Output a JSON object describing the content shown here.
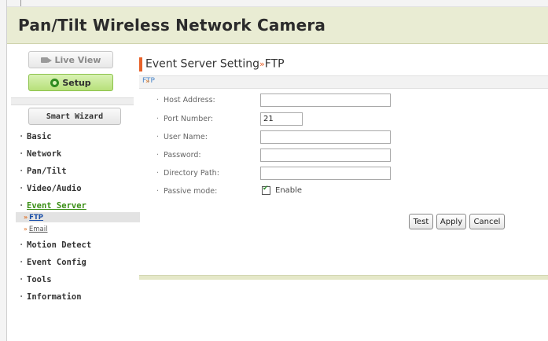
{
  "header": {
    "title": "Pan/Tilt Wireless Network Camera"
  },
  "nav": {
    "live_view": "Live View",
    "setup": "Setup",
    "smart_wizard": "Smart Wizard"
  },
  "menu": {
    "basic": "Basic",
    "network": "Network",
    "pan_tilt": "Pan/Tilt",
    "video_audio": "Video/Audio",
    "event_server": "Event Server",
    "sub_ftp": "FTP",
    "sub_email": "Email",
    "motion_detect": "Motion Detect",
    "event_config": "Event Config",
    "tools": "Tools",
    "information": "Information"
  },
  "page": {
    "title": "Event Server Setting",
    "title_sep": "»",
    "subtitle": "FTP",
    "section_prefix": "»",
    "section": "FTP"
  },
  "form": {
    "host_label": "Host Address:",
    "host_value": "",
    "port_label": "Port Number:",
    "port_value": "21",
    "user_label": "User Name:",
    "user_value": "",
    "password_label": "Password:",
    "password_value": "",
    "dir_label": "Directory Path:",
    "dir_value": "",
    "passive_label": "Passive mode:",
    "passive_checked": true,
    "passive_option": "Enable"
  },
  "buttons": {
    "test": "Test",
    "apply": "Apply",
    "cancel": "Cancel"
  },
  "colors": {
    "accent": "#e8622a",
    "header_bg": "#e9ecd3",
    "active_green": "#3b8f16",
    "link_blue": "#1a4fa8"
  }
}
